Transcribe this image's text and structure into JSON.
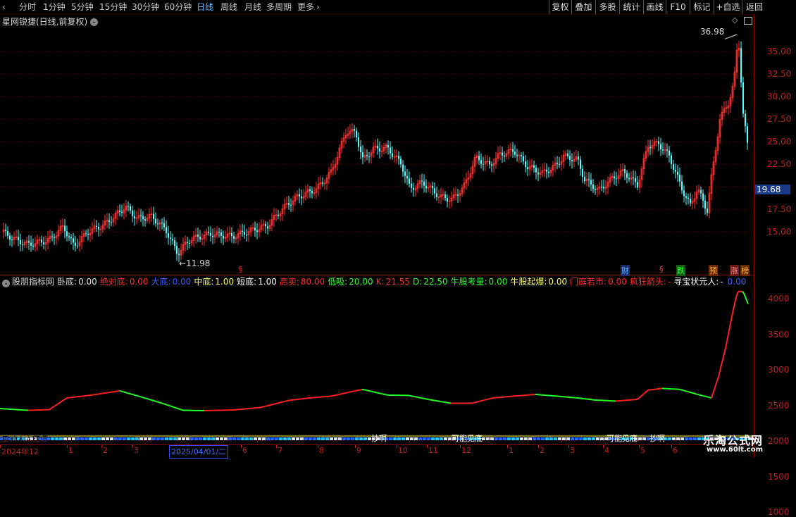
{
  "toolbar": {
    "periods": [
      "分时",
      "1分钟",
      "5分钟",
      "15分钟",
      "30分钟",
      "60分钟",
      "日线",
      "周线",
      "月线",
      "多周期",
      "更多"
    ],
    "active_period": "日线",
    "more_chevron": "›",
    "right_buttons": [
      "复权",
      "叠加",
      "多股",
      "统计",
      "画线",
      "F10",
      "标记",
      "+自选",
      "返回"
    ]
  },
  "main": {
    "title": "星网锐捷(日线,前复权)",
    "high_label": "36.98",
    "low_label": "11.98",
    "price_ticks": [
      "35.00",
      "32.50",
      "30.00",
      "27.50",
      "25.00",
      "22.50",
      "19.68",
      "17.50",
      "15.00"
    ],
    "current_price_tag": "19.68",
    "event_badges": [
      "§",
      "财",
      "§",
      "跌",
      "预",
      "涨",
      "榜"
    ]
  },
  "indicator": {
    "name": "股朋指标网",
    "items": [
      {
        "label": "卧底:",
        "value": "0.00",
        "color": "#e0e0e0"
      },
      {
        "label": "绝对底:",
        "value": "0.00",
        "color": "#ff3030"
      },
      {
        "label": "大底:",
        "value": "0.00",
        "color": "#3a5cff"
      },
      {
        "label": "中底:",
        "value": "1.00",
        "color": "#ffff60"
      },
      {
        "label": "短底:",
        "value": "1.00",
        "color": "#ffffff"
      },
      {
        "label": "高卖:",
        "value": "80.00",
        "color": "#ff3030"
      },
      {
        "label": "低吸:",
        "value": "20.00",
        "color": "#30ff30"
      },
      {
        "label": "K:",
        "value": "21.55",
        "color": "#ff3030"
      },
      {
        "label": "D:",
        "value": "22.50",
        "color": "#30ff30"
      },
      {
        "label": "牛股考量:",
        "value": "0.00",
        "color": "#30ff30"
      },
      {
        "label": "牛股起爆:",
        "value": "0.00",
        "color": "#ffff60"
      },
      {
        "label": "门庭若市:",
        "value": "0.00",
        "color": "#ff3030"
      },
      {
        "label": "疯狂箭头:",
        "value": "-",
        "color": "#ff3030"
      },
      {
        "label": "寻宝状元人:",
        "value": "-",
        "color": "#ffffff"
      },
      {
        "label": "",
        "value": "0.00",
        "color": "#3a5cff"
      }
    ],
    "value_ticks": [
      "4000",
      "3500",
      "3000",
      "2500",
      "2000",
      "1500",
      "1000"
    ],
    "bottom_labels": [
      "抄啊",
      "可能见底",
      "可能见底",
      "抄啊"
    ],
    "corner_caption": "星到太太拉进"
  },
  "dates": {
    "labels": [
      "2024年12",
      "1",
      "2",
      "3",
      "6",
      "7",
      "8",
      "9",
      "10",
      "11",
      "12",
      "1",
      "2",
      "3",
      "4",
      "5",
      "6"
    ],
    "selected": "2025/04/01/二"
  },
  "watermark": {
    "title": "乐淘公式网",
    "url": "www.60lt.com"
  },
  "colors": {
    "up": "#ff3232",
    "down": "#54ffff",
    "grid": "#6a0000",
    "accent": "#5fb4ff"
  }
}
